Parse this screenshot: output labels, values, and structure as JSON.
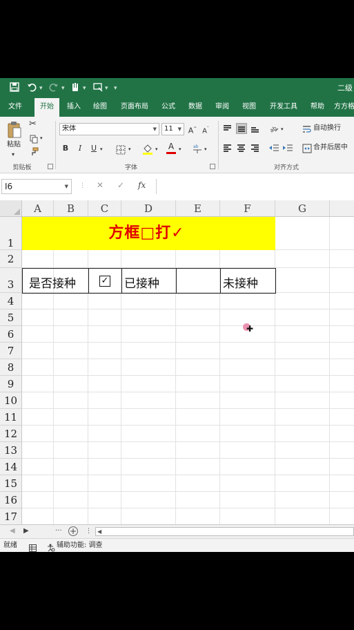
{
  "title_bar": {
    "title": "二级"
  },
  "tabs": [
    {
      "label": "文件"
    },
    {
      "label": "开始"
    },
    {
      "label": "插入"
    },
    {
      "label": "绘图"
    },
    {
      "label": "页面布局"
    },
    {
      "label": "公式"
    },
    {
      "label": "数据"
    },
    {
      "label": "审阅"
    },
    {
      "label": "视图"
    },
    {
      "label": "开发工具"
    },
    {
      "label": "帮助"
    },
    {
      "label": "方方格"
    }
  ],
  "active_tab": "开始",
  "ribbon": {
    "clipboard": {
      "paste_label": "粘贴",
      "group_label": "剪贴板"
    },
    "font": {
      "font_name": "宋体",
      "font_size": "11",
      "group_label": "字体",
      "bold": "B",
      "italic": "I",
      "underline": "U"
    },
    "alignment": {
      "wrap_text": "自动换行",
      "merge_center": "合并后居中",
      "group_label": "对齐方式"
    }
  },
  "formula_bar": {
    "name_box": "I6",
    "fx": "fx",
    "value": ""
  },
  "grid": {
    "columns": [
      "A",
      "B",
      "C",
      "D",
      "E",
      "F",
      "G"
    ],
    "rows": [
      "1",
      "2",
      "3",
      "4",
      "5",
      "6",
      "7",
      "8",
      "9",
      "10",
      "11",
      "12",
      "13",
      "14",
      "15",
      "16",
      "17"
    ],
    "title": "方框□打✓",
    "row3": {
      "label": "是否接种",
      "checkbox": "✓",
      "vaccinated": "已接种",
      "not_vaccinated": "未接种"
    }
  },
  "sheet_bar": {
    "ellipsis": "···"
  },
  "status_bar": {
    "ready": "就绪",
    "accessibility": "辅助功能: 调查"
  },
  "colors": {
    "excel_green": "#217346",
    "title_fill": "#ffff00",
    "title_text": "#e00000"
  }
}
